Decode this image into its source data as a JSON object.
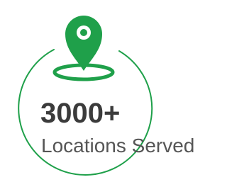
{
  "stat": {
    "value": "3000+",
    "label": "Locations Served"
  },
  "icon": {
    "name": "location-pin-icon",
    "color": "#1fa04a"
  },
  "colors": {
    "accent": "#1fa04a",
    "text_dark": "#3b3b3b",
    "text_light": "#555555"
  }
}
